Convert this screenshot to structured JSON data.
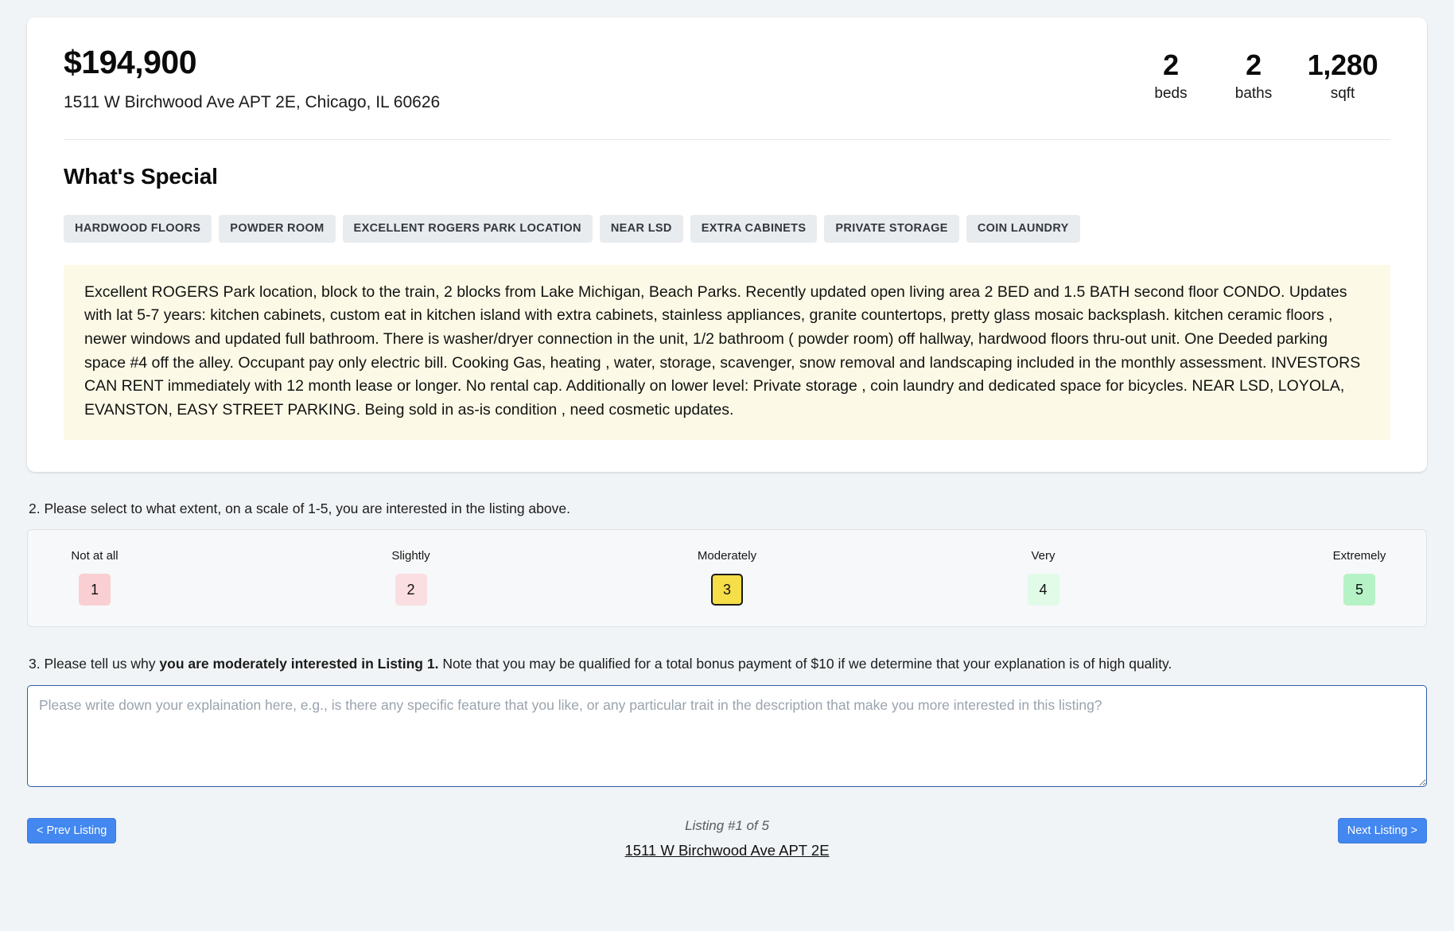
{
  "listing": {
    "price": "$194,900",
    "address": "1511 W Birchwood Ave APT 2E, Chicago, IL 60626",
    "facts": [
      {
        "value": "2",
        "label": "beds"
      },
      {
        "value": "2",
        "label": "baths"
      },
      {
        "value": "1,280",
        "label": "sqft"
      }
    ],
    "whats_special_title": "What's Special",
    "tags": [
      "HARDWOOD FLOORS",
      "POWDER ROOM",
      "EXCELLENT ROGERS PARK LOCATION",
      "NEAR LSD",
      "EXTRA CABINETS",
      "PRIVATE STORAGE",
      "COIN LAUNDRY"
    ],
    "description": "Excellent ROGERS Park location, block to the train, 2 blocks from Lake Michigan, Beach Parks. Recently updated open living area 2 BED and 1.5 BATH second floor CONDO. Updates with lat 5-7 years: kitchen cabinets, custom eat in kitchen island with extra cabinets, stainless appliances, granite countertops, pretty glass mosaic backsplash. kitchen ceramic floors , newer windows and updated full bathroom. There is washer/dryer connection in the unit, 1/2 bathroom ( powder room) off hallway, hardwood floors thru-out unit. One Deeded parking space #4 off the alley. Occupant pay only electric bill. Cooking Gas, heating , water, storage, scavenger, snow removal and landscaping included in the monthly assessment. INVESTORS CAN RENT immediately with 12 month lease or longer. No rental cap. Additionally on lower level: Private storage , coin laundry and dedicated space for bicycles. NEAR LSD, LOYOLA, EVANSTON, EASY STREET PARKING. Being sold in as-is condition , need cosmetic updates."
  },
  "question2": {
    "text": "2. Please select to what extent, on a scale of 1-5, you are interested in the listing above.",
    "options": [
      {
        "label": "Not at all",
        "value": "1",
        "color": "#f9cfd3",
        "selected": false
      },
      {
        "label": "Slightly",
        "value": "2",
        "color": "#fbdee1",
        "selected": false
      },
      {
        "label": "Moderately",
        "value": "3",
        "color": "#f5de48",
        "selected": true
      },
      {
        "label": "Very",
        "value": "4",
        "color": "#e1fbe8",
        "selected": false
      },
      {
        "label": "Extremely",
        "value": "5",
        "color": "#b5f2c6",
        "selected": false
      }
    ]
  },
  "question3": {
    "prefix": "3. Please tell us why ",
    "bold": "you are moderately interested in Listing 1.",
    "suffix": " Note that you may be qualified for a total bonus payment of $10 if we determine that your explanation is of high quality.",
    "textarea_value": "",
    "textarea_placeholder": "Please write down your explaination here, e.g., is there any specific feature that you like, or any particular trait in the description that make you more interested in this listing?"
  },
  "bottom_nav": {
    "prev_label": "< Prev Listing",
    "next_label": "Next Listing >",
    "counter": "Listing #1 of 5",
    "current_listing": "1511 W Birchwood Ave APT 2E"
  }
}
